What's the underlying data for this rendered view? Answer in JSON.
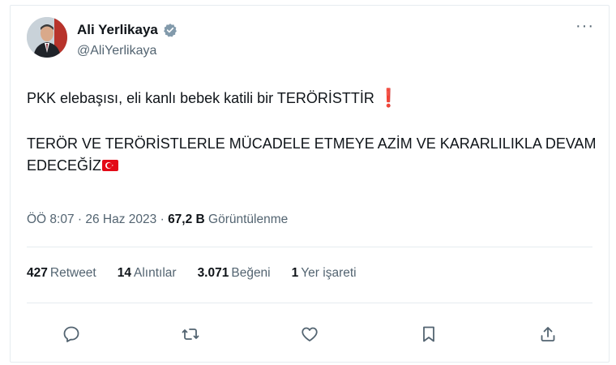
{
  "tweet": {
    "author_name": "Ali Yerlikaya",
    "author_handle": "@AliYerlikaya",
    "line1": "PKK elebaşısı, eli kanlı bebek katili bir TERÖRİSTTİR",
    "line1_emoji": "❗",
    "line2": "TERÖR VE TERÖRİSTLERLE MÜCADELE ETMEYE AZİM VE KARARLILIKLA DEVAM EDECEĞİZ",
    "more_label": "···"
  },
  "meta": {
    "time": "ÖÖ 8:07",
    "date": "26 Haz 2023",
    "views_count": "67,2 B",
    "views_label": "Görüntülenme",
    "separator": " · "
  },
  "stats": {
    "retweets_count": "427",
    "retweets_label": "Retweet",
    "quotes_count": "14",
    "quotes_label": "Alıntılar",
    "likes_count": "3.071",
    "likes_label": "Beğeni",
    "bookmarks_count": "1",
    "bookmarks_label": "Yer işareti"
  },
  "icons": {
    "verified": "verified-badge-icon",
    "reply": "reply-icon",
    "retweet": "retweet-icon",
    "like": "heart-icon",
    "bookmark": "bookmark-icon",
    "share": "share-icon"
  },
  "colors": {
    "text": "#0f1419",
    "secondary": "#536471",
    "border": "#e6ecf0",
    "verified": "#829aab",
    "flag_red": "#e30a17",
    "exclamation_red": "#d1293b"
  }
}
